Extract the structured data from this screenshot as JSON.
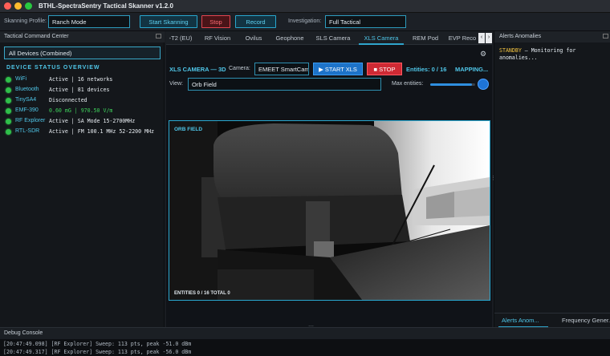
{
  "window": {
    "title": "BTHL-SpectraSentry Tactical Skanner v1.2.0"
  },
  "toolbar": {
    "profile_label": "Skanning Profile:",
    "profile_value": "Ranch Mode",
    "start_label": "Start Skanning",
    "stop_label": "Stop",
    "record_label": "Record",
    "investigation_label": "Investigation:",
    "investigation_value": "Full Tactical"
  },
  "left_panel": {
    "title": "Tactical Command Center",
    "device_filter": "All Devices (Combined)",
    "section_title": "DEVICE STATUS OVERVIEW",
    "devices": [
      {
        "name": "WiFi",
        "status": "Active | 16 networks"
      },
      {
        "name": "Bluetooth",
        "status": "Active | 81 devices"
      },
      {
        "name": "TinySA4",
        "status": "Disconnected"
      },
      {
        "name": "EMF-390",
        "status": "0.60 mG | 970.50 V/m"
      },
      {
        "name": "RF Explorer",
        "status": "Active | SA Mode  15-2700MHz"
      },
      {
        "name": "RTL-SDR",
        "status": "Active | FM 100.1 MHz  52-2200 MHz"
      }
    ],
    "status_colors": {
      "active": "#2fbf4a",
      "reading": "#3fd35c",
      "accent": "#4fc6e8"
    }
  },
  "tabs": {
    "items": [
      "-T2 (EU)",
      "RF Vision",
      "Ovilus",
      "Geophone",
      "SLS Camera",
      "XLS Camera",
      "REM Pod",
      "EVP Reco"
    ],
    "active": "XLS Camera",
    "prev_arrow": "‹",
    "next_arrow": "›"
  },
  "xls": {
    "title": "XLS CAMERA — 3D",
    "camera_label": "Camera:",
    "camera_value": "EMEET SmartCam",
    "start_label": "▶ START XLS",
    "stop_label": "■ STOP",
    "entities": "Entities: 0 / 16",
    "mapping": "MAPPING...",
    "view_label": "View:",
    "view_value": "Orb Field",
    "max_label": "Max entities:",
    "max_fraction": 0.93,
    "feed_label": "ORB FIELD",
    "feed_footer": "ENTITIES 0 / 16   TOTAL 0"
  },
  "right_panel": {
    "title": "Alerts  Anomalies",
    "standby": "STANDBY",
    "message": " — Monitoring for anomalies...",
    "bottom_tabs": [
      "Alerts  Anom...",
      "Frequency Gener..."
    ]
  },
  "debug": {
    "title": "Debug Console",
    "lines": [
      "[20:47:49.098] [RF Explorer] Sweep: 113 pts, peak -51.0 dBm",
      "[20:47:49.317] [RF Explorer] Sweep: 113 pts, peak -56.0 dBm"
    ]
  }
}
